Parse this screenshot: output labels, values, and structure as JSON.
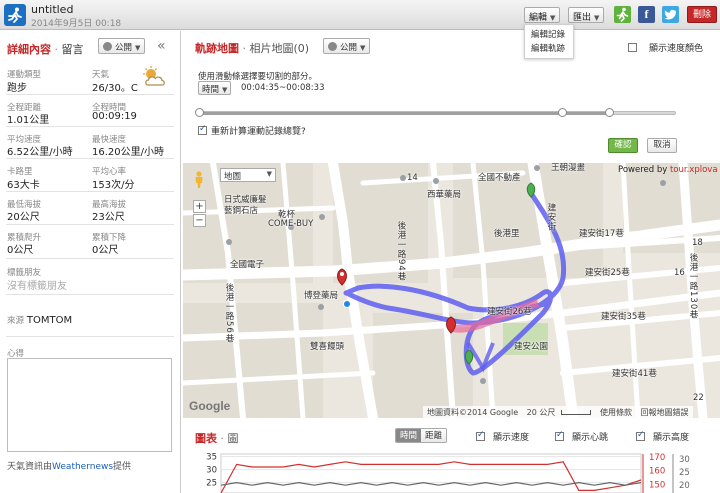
{
  "header": {
    "title": "untitled",
    "date": "2014年9月5日 00:18",
    "edit_label": "編輯",
    "export_label": "匯出",
    "facebook_icon_text": "f",
    "delete_label": "刪除",
    "edit_menu": [
      "編輯記錄",
      "編輯軌跡"
    ]
  },
  "left_panel": {
    "title": "詳細內容",
    "subtitle": "留言",
    "share_label": "公開",
    "stats": [
      {
        "label": "運動類型",
        "value": "跑步"
      },
      {
        "label": "天氣",
        "value": "26/30。C"
      },
      {
        "label": "全程距離",
        "value": "1.01公里"
      },
      {
        "label": "全程時間",
        "value": "00:09:19"
      },
      {
        "label": "平均速度",
        "value": "6.52公里/小時"
      },
      {
        "label": "最快速度",
        "value": "16.20公里/小時"
      },
      {
        "label": "卡路里",
        "value": "63大卡"
      },
      {
        "label": "平均心率",
        "value": "153次/分"
      },
      {
        "label": "最低海拔",
        "value": "20公尺"
      },
      {
        "label": "最高海拔",
        "value": "23公尺"
      },
      {
        "label": "累積爬升",
        "value": "0公尺"
      },
      {
        "label": "累積下降",
        "value": "0公尺"
      }
    ],
    "tagged_friends_label": "標籤朋友",
    "tagged_friends_value": "沒有標籤朋友",
    "source_label": "來源",
    "source_value": "TOMTOM",
    "notes_label": "心得",
    "weather_credit_prefix": "天氣資訊由",
    "weather_credit_link": "Weathernews",
    "weather_credit_suffix": "提供"
  },
  "track_panel": {
    "title": "軌跡地圖",
    "subtitle": "相片地圖(0)",
    "share_label": "公開",
    "speed_color_label": "顯示速度顏色",
    "hint": "使用滑動條選擇要切割的部分。",
    "time_select": "時間",
    "time_range": "00:04:35~00:08:33",
    "recalc_label": "重新計算運動記錄總覽?",
    "confirm_label": "確認",
    "cancel_label": "取消",
    "slider_start_fraction": 0.0,
    "slider_end_fraction": 0.86,
    "slider_mid_fraction": 0.76
  },
  "map": {
    "type_select": "地圖",
    "powered_prefix": "Powered by ",
    "powered_link": "tour.xplova",
    "google_logo": "Google",
    "credits_data": "地圖資料©2014 Google",
    "credits_scale": "20 公尺",
    "credits_terms": "使用條款",
    "credits_report": "回報地圖錯誤",
    "zoom_in": "+",
    "zoom_out": "−",
    "labels": {
      "shop1": "日式威廉髮",
      "shop2": "藝鋼石店",
      "ganbei": "乾杯",
      "comebuy": "COME-BUY",
      "telecom": "全國電子",
      "pharmacy": "博登藥局",
      "bank": "雙喜饅頭",
      "xipin": "西華藥局",
      "realestate": "全國不動產",
      "houganli": "後港里",
      "wangchuan": "王朝漫畫",
      "jianan17": "建安街17巷",
      "jianan25": "建安街25巷",
      "jianan35": "建安街35巷",
      "jianan41": "建安街41巷",
      "jianan26": "建安街26巷",
      "jiananpark": "建安公園",
      "road194": "後港一路94巷",
      "road156": "後港一路56巷",
      "jiananjie": "建安街",
      "road130": "後港一路130巷",
      "num14": "14",
      "num16": "16",
      "num18": "18",
      "num22": "22"
    }
  },
  "chart_panel": {
    "title": "圖表",
    "subtitle": "圖",
    "toggle_time": "時間",
    "toggle_distance": "距離",
    "show_speed": "顯示速度",
    "show_heart": "顯示心跳",
    "show_altitude": "顯示高度"
  },
  "colors": {
    "accent_red": "#c62828",
    "track": "#5e5ef0",
    "track_highlight": "#e86a9a",
    "confirm_green": "#74b84a",
    "heart_line": "#d32f2f",
    "speed_line": "#666666"
  },
  "chart_data": {
    "type": "line",
    "series": [
      {
        "values": [
          21,
          32,
          31,
          31,
          31,
          32,
          31,
          32,
          33,
          32,
          32,
          32,
          32,
          32,
          32,
          33,
          32,
          32,
          32,
          32,
          32,
          32,
          33,
          22,
          22,
          23,
          24,
          26
        ]
      },
      {
        "values": [
          24,
          25,
          24,
          25,
          24,
          25,
          24,
          25,
          24,
          25,
          24,
          25,
          24,
          25,
          24,
          25,
          24,
          25,
          24,
          25,
          24,
          25,
          24,
          25,
          24,
          25,
          24,
          25
        ]
      }
    ],
    "left_axis": {
      "ticks": [
        35,
        30,
        25
      ],
      "range": [
        21,
        36
      ]
    },
    "right_axis_red": {
      "ticks": [
        170,
        160,
        150
      ],
      "range": [
        144,
        172
      ]
    },
    "right_axis_gray": {
      "ticks": [
        30,
        25,
        20
      ],
      "range": [
        17,
        32
      ]
    }
  }
}
